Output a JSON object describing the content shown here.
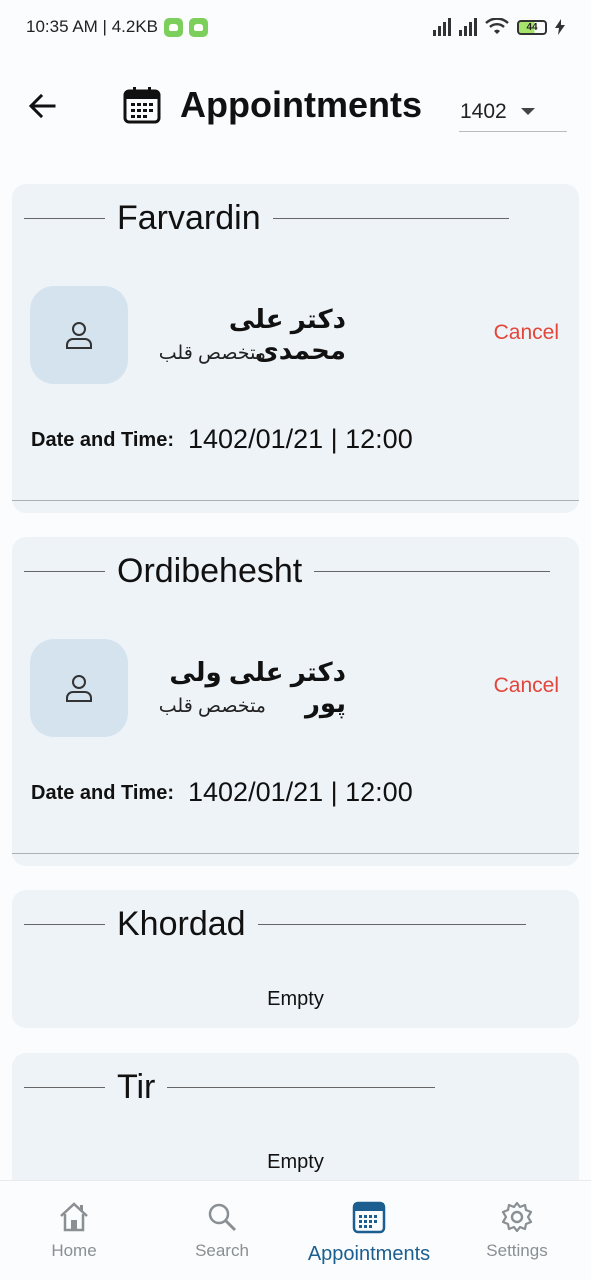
{
  "status_bar": {
    "time_speed": "10:35 AM | 4.2KB",
    "battery": "44"
  },
  "header": {
    "title": "Appointments",
    "year": "1402"
  },
  "months": [
    {
      "name": "Farvardin",
      "appointment": {
        "doctor": "دکتر علی محمدی",
        "specialty": "متخصص قلب",
        "cancel_label": "Cancel",
        "datetime_label": "Date and Time:",
        "datetime_value": "1402/01/21 | 12:00"
      }
    },
    {
      "name": "Ordibehesht",
      "appointment": {
        "doctor": "دکتر علی ولی پور",
        "specialty": "متخصص قلب",
        "cancel_label": "Cancel",
        "datetime_label": "Date and Time:",
        "datetime_value": "1402/01/21 | 12:00"
      }
    },
    {
      "name": "Khordad",
      "empty_label": "Empty"
    },
    {
      "name": "Tir",
      "empty_label": "Empty"
    }
  ],
  "bottom_nav": {
    "items": [
      {
        "label": "Home",
        "icon": "home-icon"
      },
      {
        "label": "Search",
        "icon": "search-icon"
      },
      {
        "label": "Appointments",
        "icon": "calendar-icon",
        "active": true
      },
      {
        "label": "Settings",
        "icon": "gear-icon"
      }
    ]
  },
  "colors": {
    "accent": "#1c5e8f",
    "cancel": "#e2463b",
    "card_bg": "#eef3f8",
    "avatar_bg": "#d5e3ef"
  }
}
